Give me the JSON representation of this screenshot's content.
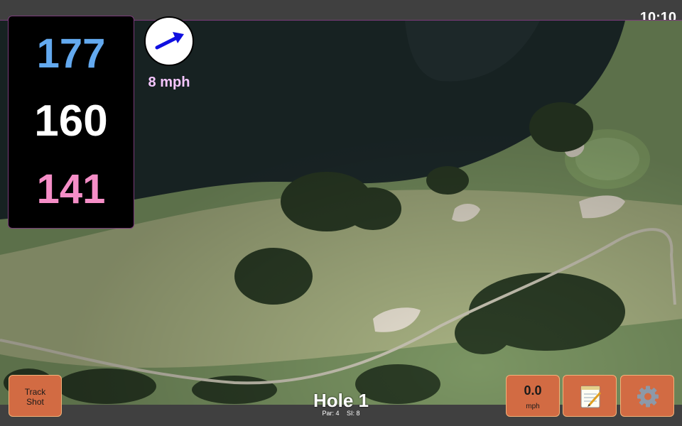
{
  "status_bar": {
    "time": "10:10"
  },
  "distances": {
    "back": "177",
    "center": "160",
    "front": "141"
  },
  "wind": {
    "speed_label": "8 mph",
    "direction_icon": "arrow-icon"
  },
  "hole": {
    "title": "Hole 1",
    "par": "Par: 4",
    "si": "SI: 8"
  },
  "buttons": {
    "track_shot_line1": "Track",
    "track_shot_line2": "Shot",
    "wind_value": "0.0",
    "wind_unit": "mph",
    "notes_icon": "notepad-icon",
    "settings_icon": "gear-icon"
  },
  "colors": {
    "back_distance": "#63a9ef",
    "center_distance": "#ffffff",
    "front_distance": "#f58ec7",
    "button_bg": "#d26b43",
    "wind_label": "#f5c6ff",
    "wind_arrow": "#1010e0"
  }
}
